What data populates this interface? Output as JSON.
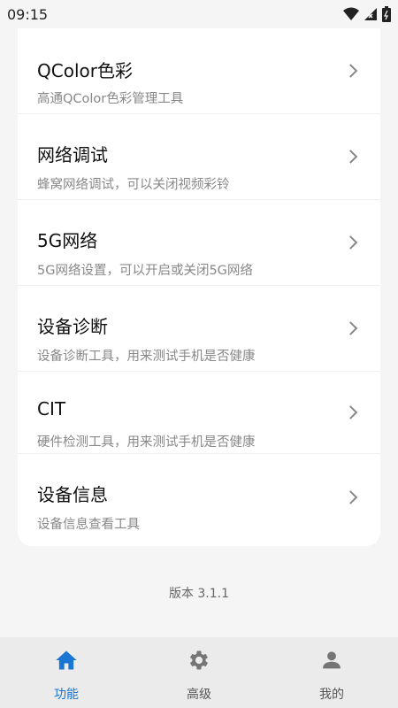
{
  "status_bar": {
    "time": "09:15"
  },
  "items": [
    {
      "title": "QColor色彩",
      "subtitle": "高通QColor色彩管理工具"
    },
    {
      "title": "网络调试",
      "subtitle": "蜂窝网络调试，可以关闭视频彩铃"
    },
    {
      "title": "5G网络",
      "subtitle": "5G网络设置，可以开启或关闭5G网络"
    },
    {
      "title": "设备诊断",
      "subtitle": "设备诊断工具，用来测试手机是否健康"
    },
    {
      "title": "CIT",
      "subtitle": "硬件检测工具，用来测试手机是否健康"
    },
    {
      "title": "设备信息",
      "subtitle": "设备信息查看工具"
    }
  ],
  "version": "版本 3.1.1",
  "bottom_nav": [
    {
      "label": "功能",
      "icon": "home-icon",
      "active": true
    },
    {
      "label": "高级",
      "icon": "gear-icon",
      "active": false
    },
    {
      "label": "我的",
      "icon": "person-icon",
      "active": false
    }
  ],
  "colors": {
    "accent": "#1976d2",
    "card": "#ffffff",
    "background": "#f5f5f5"
  }
}
